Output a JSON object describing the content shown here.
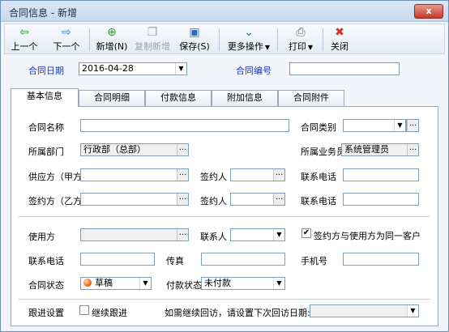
{
  "window": {
    "title": "合同信息 - 新增",
    "close": "x"
  },
  "toolbar": {
    "prev": "上一个",
    "next": "下一个",
    "add": "新增(N)",
    "copy_add": "复制新增",
    "save": "保存(S)",
    "more": "更多操作",
    "print": "打印",
    "close": "关闭"
  },
  "header": {
    "date_label": "合同日期",
    "date_value": "2016-04-28",
    "number_label": "合同编号",
    "number_value": ""
  },
  "tabs": [
    "基本信息",
    "合同明细",
    "付款信息",
    "附加信息",
    "合同附件"
  ],
  "form": {
    "contract_name_label": "合同名称",
    "contract_name_value": "",
    "contract_type_label": "合同类别",
    "contract_type_value": "",
    "dept_label": "所属部门",
    "dept_value": "行政部（总部）",
    "salesman_label": "所属业务员",
    "salesman_value": "系统管理员",
    "supplier_label": "供应方（甲方）",
    "signer1_label": "签约人",
    "phone1_label": "联系电话",
    "partyb_label": "签约方（乙方）",
    "signer2_label": "签约人",
    "phone2_label": "联系电话",
    "user_label": "使用方",
    "contact_label": "联系人",
    "same_customer_label": "签约方与使用方为同一客户",
    "same_customer_checked": true,
    "phone3_label": "联系电话",
    "fax_label": "传真",
    "mobile_label": "手机号",
    "status_label": "合同状态",
    "status_value": "草稿",
    "pay_status_label": "付款状态",
    "pay_status_value": "未付款",
    "follow_label": "跟进设置",
    "follow_checkbox_label": "继续跟进",
    "follow_checked": false,
    "next_visit_label": "如需继续回访，请设置下次回访日期:",
    "next_visit_value": ""
  },
  "colors": {
    "accent": "#1836c6",
    "border": "#7f9db9",
    "status": "#f06a12"
  },
  "icons": {
    "prev": "left-arrow-icon",
    "next": "right-arrow-icon",
    "add": "plus-circle-icon",
    "copy": "copy-icon",
    "save": "save-icon",
    "more": "double-chevron-icon",
    "print": "printer-icon",
    "close": "close-icon"
  }
}
